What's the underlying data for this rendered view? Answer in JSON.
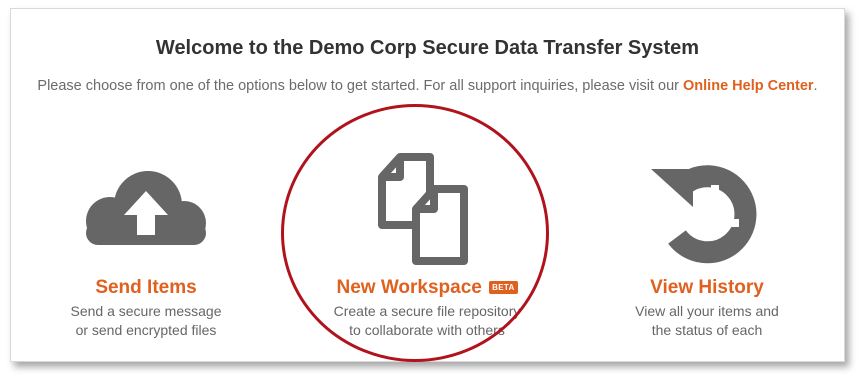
{
  "header": {
    "title": "Welcome to the Demo Corp Secure Data Transfer System",
    "intro": "Please choose from one of the options below to get started. For all support inquiries, please visit our ",
    "help_link": "Online Help Center",
    "intro_end": "."
  },
  "options": [
    {
      "icon": "cloud-upload-icon",
      "label": "Send Items",
      "desc_line1": "Send a secure message",
      "desc_line2": "or send encrypted files"
    },
    {
      "icon": "documents-icon",
      "label": "New Workspace",
      "badge": "BETA",
      "desc_line1": "Create a secure file repository",
      "desc_line2": "to collaborate with others"
    },
    {
      "icon": "history-icon",
      "label": "View History",
      "desc_line1": "View all your items and",
      "desc_line2": "the status of each"
    }
  ],
  "colors": {
    "accent": "#e0611f",
    "icon": "#666666",
    "highlight_ring": "#b0131b"
  }
}
